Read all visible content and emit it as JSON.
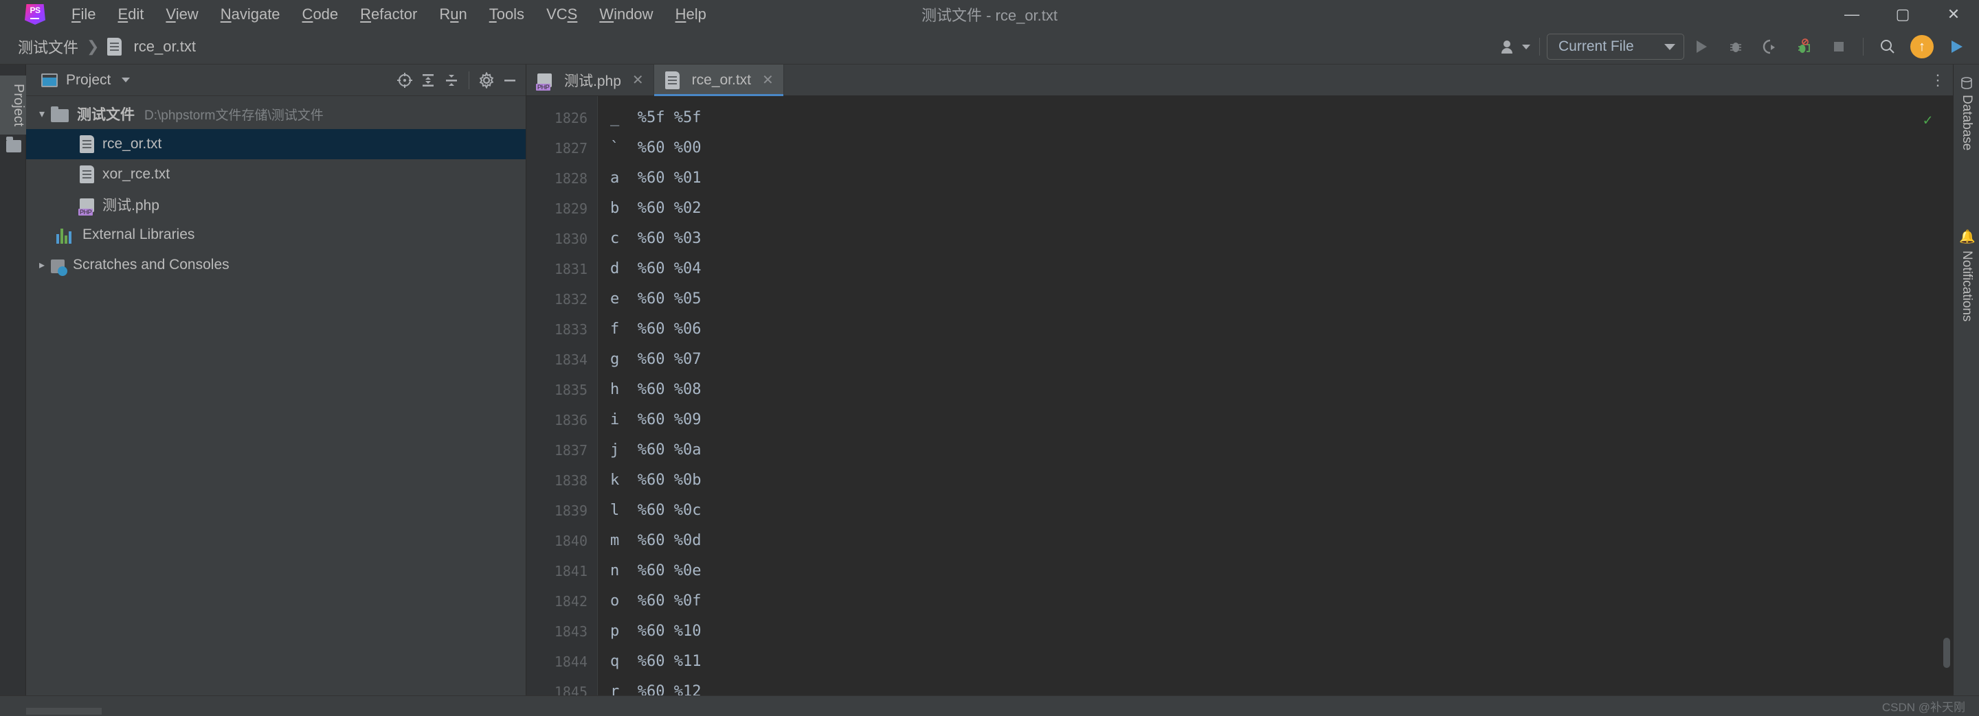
{
  "window": {
    "title": "测试文件 - rce_or.txt",
    "logo_text": "PS",
    "minimize": "—",
    "maximize": "▢",
    "close": "✕"
  },
  "menubar": {
    "items": [
      {
        "label": "File",
        "mnemonic": "F"
      },
      {
        "label": "Edit",
        "mnemonic": "E"
      },
      {
        "label": "View",
        "mnemonic": "V"
      },
      {
        "label": "Navigate",
        "mnemonic": "N"
      },
      {
        "label": "Code",
        "mnemonic": "C"
      },
      {
        "label": "Refactor",
        "mnemonic": "R"
      },
      {
        "label": "Run",
        "mnemonic": "u"
      },
      {
        "label": "Tools",
        "mnemonic": "T"
      },
      {
        "label": "VCS",
        "mnemonic": "S"
      },
      {
        "label": "Window",
        "mnemonic": "W"
      },
      {
        "label": "Help",
        "mnemonic": "H"
      }
    ]
  },
  "breadcrumb": {
    "project": "测试文件",
    "separator": "❯",
    "file": "rce_or.txt",
    "file_icon": "text-file-icon"
  },
  "nav_toolbar": {
    "avatar_icon": "user-avatar-icon",
    "run_config": "Current File",
    "icons": [
      {
        "name": "run-icon",
        "glyph": "▶"
      },
      {
        "name": "debug-icon",
        "glyph": "🐞"
      },
      {
        "name": "run-with-coverage-icon",
        "glyph": "◖"
      },
      {
        "name": "profiler-icon",
        "glyph": "⫙"
      },
      {
        "name": "stop-icon",
        "glyph": "■"
      },
      {
        "name": "search-everywhere-icon",
        "glyph": "🔍"
      }
    ],
    "update_badge": "↑",
    "ide_play": "▶"
  },
  "left_strip": {
    "project_tab": "Project"
  },
  "right_strip": {
    "database": "Database",
    "notifications": "Notifications"
  },
  "project_panel": {
    "title": "Project",
    "title_caret": "▼",
    "tools": [
      {
        "name": "locate-icon",
        "glyph": "◎"
      },
      {
        "name": "expand-all-icon",
        "glyph": "⇕"
      },
      {
        "name": "collapse-all-icon",
        "glyph": "⇕"
      },
      {
        "name": "settings-gear-icon",
        "glyph": "⚙"
      },
      {
        "name": "hide-panel-icon",
        "glyph": "—"
      }
    ],
    "tree": [
      {
        "label": "测试文件",
        "path": "D:\\phpstorm文件存储\\测试文件",
        "icon": "folder-icon",
        "arrow": "open",
        "indent": 0,
        "selected": false,
        "bold": true
      },
      {
        "label": "rce_or.txt",
        "path": "",
        "icon": "text-file-icon",
        "arrow": "none",
        "indent": 2,
        "selected": true,
        "bold": false
      },
      {
        "label": "xor_rce.txt",
        "path": "",
        "icon": "text-file-icon",
        "arrow": "none",
        "indent": 2,
        "selected": false,
        "bold": false
      },
      {
        "label": "测试.php",
        "path": "",
        "icon": "php-file-icon",
        "arrow": "none",
        "indent": 2,
        "selected": false,
        "bold": false
      },
      {
        "label": "External Libraries",
        "path": "",
        "icon": "libraries-icon",
        "arrow": "none",
        "indent": 1,
        "selected": false,
        "bold": false
      },
      {
        "label": "Scratches and Consoles",
        "path": "",
        "icon": "scratches-icon",
        "arrow": "closed",
        "indent": 0,
        "selected": false,
        "bold": false
      }
    ]
  },
  "editor": {
    "tabs": [
      {
        "label": "测试.php",
        "icon": "php-file-icon",
        "active": false,
        "close": "✕"
      },
      {
        "label": "rce_or.txt",
        "icon": "text-file-icon",
        "active": true,
        "close": "✕"
      }
    ],
    "kebab": "⋮",
    "inspection_status": "✓",
    "lines": [
      {
        "num": "1826",
        "text": "_  %5f %5f"
      },
      {
        "num": "1827",
        "text": "`  %60 %00"
      },
      {
        "num": "1828",
        "text": "a  %60 %01"
      },
      {
        "num": "1829",
        "text": "b  %60 %02"
      },
      {
        "num": "1830",
        "text": "c  %60 %03"
      },
      {
        "num": "1831",
        "text": "d  %60 %04"
      },
      {
        "num": "1832",
        "text": "e  %60 %05"
      },
      {
        "num": "1833",
        "text": "f  %60 %06"
      },
      {
        "num": "1834",
        "text": "g  %60 %07"
      },
      {
        "num": "1835",
        "text": "h  %60 %08"
      },
      {
        "num": "1836",
        "text": "i  %60 %09"
      },
      {
        "num": "1837",
        "text": "j  %60 %0a"
      },
      {
        "num": "1838",
        "text": "k  %60 %0b"
      },
      {
        "num": "1839",
        "text": "l  %60 %0c"
      },
      {
        "num": "1840",
        "text": "m  %60 %0d"
      },
      {
        "num": "1841",
        "text": "n  %60 %0e"
      },
      {
        "num": "1842",
        "text": "o  %60 %0f"
      },
      {
        "num": "1843",
        "text": "p  %60 %10"
      },
      {
        "num": "1844",
        "text": "q  %60 %11"
      },
      {
        "num": "1845",
        "text": "r  %60 %12"
      }
    ]
  },
  "statusbar": {
    "watermark": "CSDN @补天刚"
  },
  "colors": {
    "accent_blue": "#4a88c7",
    "selection": "#0d293e",
    "editor_bg": "#2b2b2b",
    "panel_bg": "#3c3f41",
    "text": "#bbbbbb",
    "code_text": "#a9b7c6",
    "update_orange": "#f0a732"
  }
}
